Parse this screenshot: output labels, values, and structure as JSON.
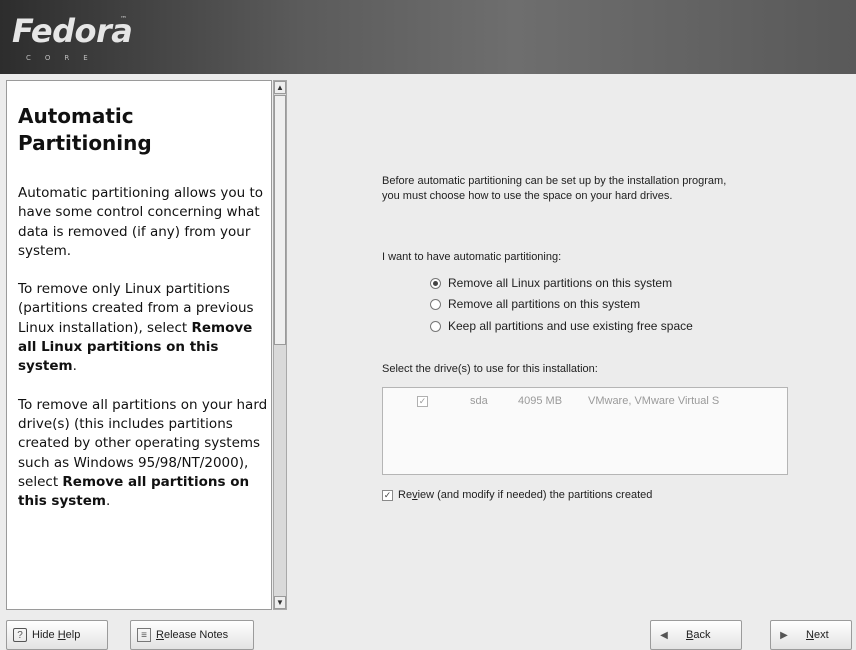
{
  "branding": {
    "logo_text": "Fedora",
    "logo_tm": "™",
    "logo_sub": "CORE"
  },
  "help": {
    "title_line1": "Automatic",
    "title_line2": "Partitioning",
    "p1": "Automatic partitioning allows you to have some control concerning what data is removed (if any) from your system.",
    "p2_pre": "To remove only Linux partitions (partitions created from a previous Linux installation), select ",
    "p2_bold": "Remove all Linux partitions on this system",
    "p2_post": ".",
    "p3_pre": "To remove all partitions on your hard drive(s) (this includes partitions created by other operating systems such as Windows 95/98/NT/2000), select ",
    "p3_bold": "Remove all partitions on this system",
    "p3_post": "."
  },
  "main": {
    "intro": "Before automatic partitioning can be set up by the installation program, you must choose how to use the space on your hard drives.",
    "question": "I want to have automatic partitioning:",
    "options": [
      {
        "label": "Remove all Linux partitions on this system",
        "selected": true
      },
      {
        "label": "Remove all partitions on this system",
        "selected": false
      },
      {
        "label": "Keep all partitions and use existing free space",
        "selected": false
      }
    ],
    "drive_label": "Select the drive(s) to use for this installation:",
    "drives": [
      {
        "checked": true,
        "device": "sda",
        "size": "4095 MB",
        "model": "VMware, VMware Virtual S"
      }
    ],
    "review": {
      "checked": true,
      "pre": "Re",
      "accel": "v",
      "post": "iew (and modify if needed) the partitions created"
    }
  },
  "buttons": {
    "hide_help": {
      "pre": "Hide ",
      "accel": "H",
      "post": "elp"
    },
    "release_notes": {
      "pre": "",
      "accel": "R",
      "post": "elease Notes"
    },
    "back": {
      "pre": "",
      "accel": "B",
      "post": "ack"
    },
    "next": {
      "pre": "",
      "accel": "N",
      "post": "ext"
    }
  },
  "icons": {
    "scroll_up": "▲",
    "scroll_down": "▼",
    "check": "✓",
    "back": "◀",
    "next": "▶",
    "help": "?",
    "notes": "≡"
  }
}
